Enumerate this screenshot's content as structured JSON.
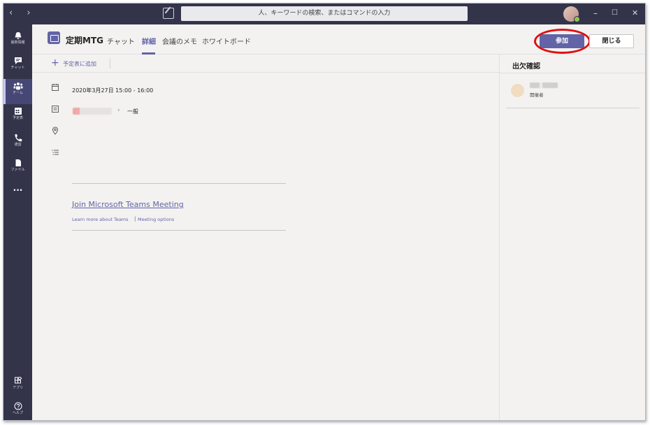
{
  "titlebar": {
    "nav_back": "‹",
    "nav_forward": "›",
    "search_placeholder": "人、キーワードの検索、またはコマンドの入力",
    "minimize": "–",
    "maximize": "☐",
    "close": "✕"
  },
  "rail": {
    "items": [
      {
        "label": "最新情報",
        "icon": "bell-icon"
      },
      {
        "label": "チャット",
        "icon": "chat-icon"
      },
      {
        "label": "チーム",
        "icon": "teams-icon"
      },
      {
        "label": "予定表",
        "icon": "calendar-icon"
      },
      {
        "label": "通話",
        "icon": "phone-icon"
      },
      {
        "label": "ファイル",
        "icon": "file-icon"
      },
      {
        "label": "アプリ",
        "icon": "apps-icon"
      },
      {
        "label": "ヘルプ",
        "icon": "help-icon"
      }
    ],
    "more": "···"
  },
  "header": {
    "title": "定期MTG",
    "tabs": [
      "チャット",
      "詳細",
      "会議のメモ",
      "ホワイトボード"
    ],
    "join_label": "参加",
    "close_label": "閉じる"
  },
  "toolbar": {
    "add_to_calendar": "予定表に追加"
  },
  "details": {
    "datetime": "2020年3月27日 15:00 - 16:00",
    "channel": "一般",
    "join_link": "Join Microsoft Teams Meeting",
    "learn_more": "Learn more about Teams",
    "separator": "|",
    "meeting_options": "Meeting options"
  },
  "attendance": {
    "title": "出欠確認",
    "organizer_role": "開催者"
  },
  "colors": {
    "rail": "#33344a",
    "accent": "#6264a7",
    "highlight": "#e01010"
  }
}
